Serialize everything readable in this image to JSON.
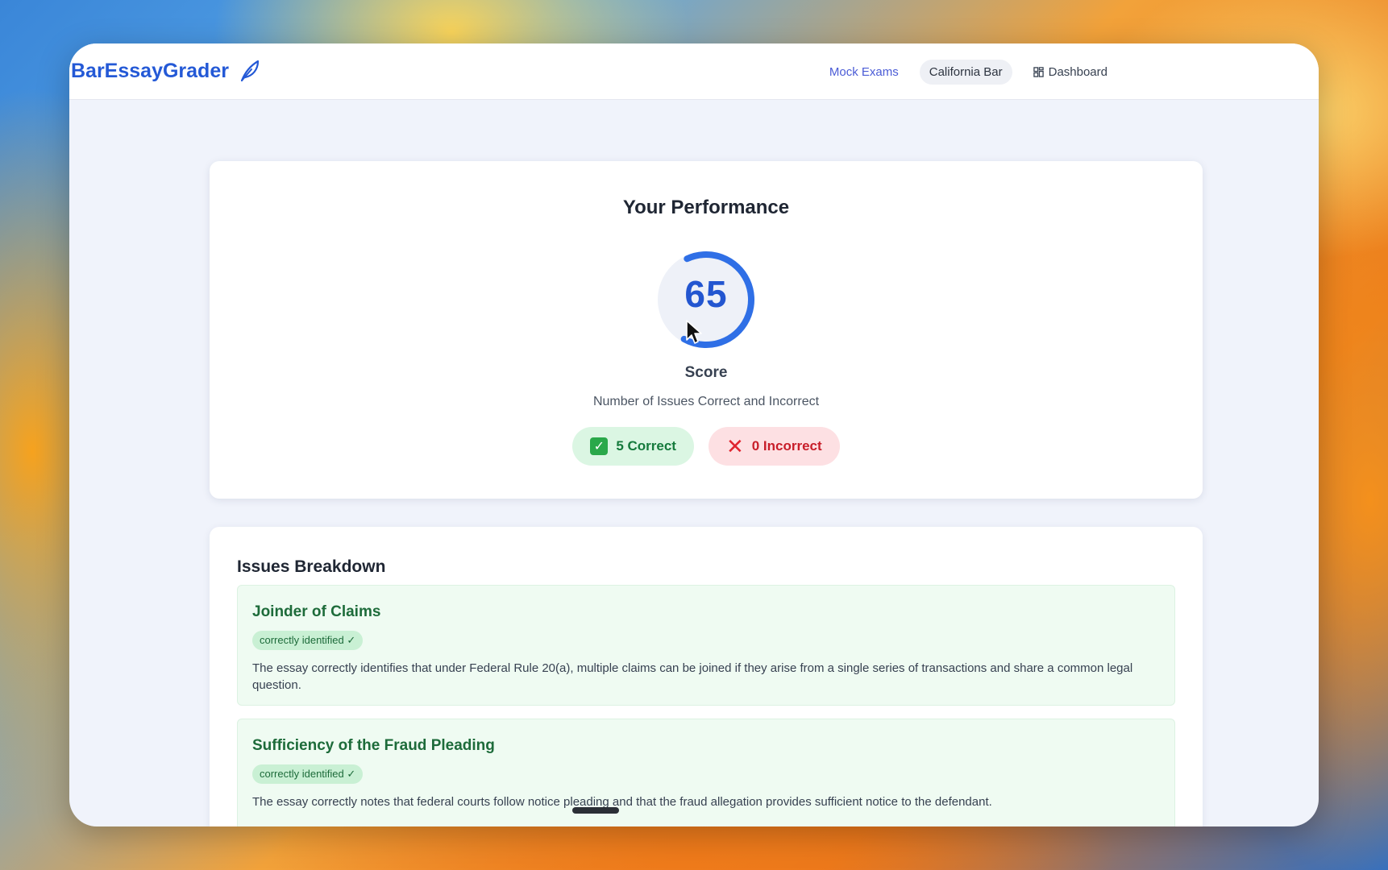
{
  "app": {
    "brand_name": "BarEssayGrader",
    "brand_icon": "feather-icon",
    "accent_color": "#2459d6"
  },
  "nav": {
    "mock_exams": "Mock Exams",
    "california_bar": "California Bar",
    "dashboard": "Dashboard",
    "dashboard_icon": "grid-icon"
  },
  "performance": {
    "title": "Your Performance",
    "score_value": "65",
    "score_fraction": 0.65,
    "score_label": "Score",
    "subtitle": "Number of Issues Correct and Incorrect",
    "correct_label": "5 Correct",
    "incorrect_label": "0 Incorrect"
  },
  "issues": {
    "title": "Issues Breakdown",
    "items": [
      {
        "title": "Joinder of Claims",
        "badge": "correctly identified ✓",
        "text": "The essay correctly identifies that under Federal Rule 20(a), multiple claims can be joined if they arise from a single series of transactions and share a common legal question."
      },
      {
        "title": "Sufficiency of the Fraud Pleading",
        "badge": "correctly identified ✓",
        "text": "The essay correctly notes that federal courts follow notice pleading and that the fraud allegation provides sufficient notice to the defendant."
      }
    ]
  }
}
